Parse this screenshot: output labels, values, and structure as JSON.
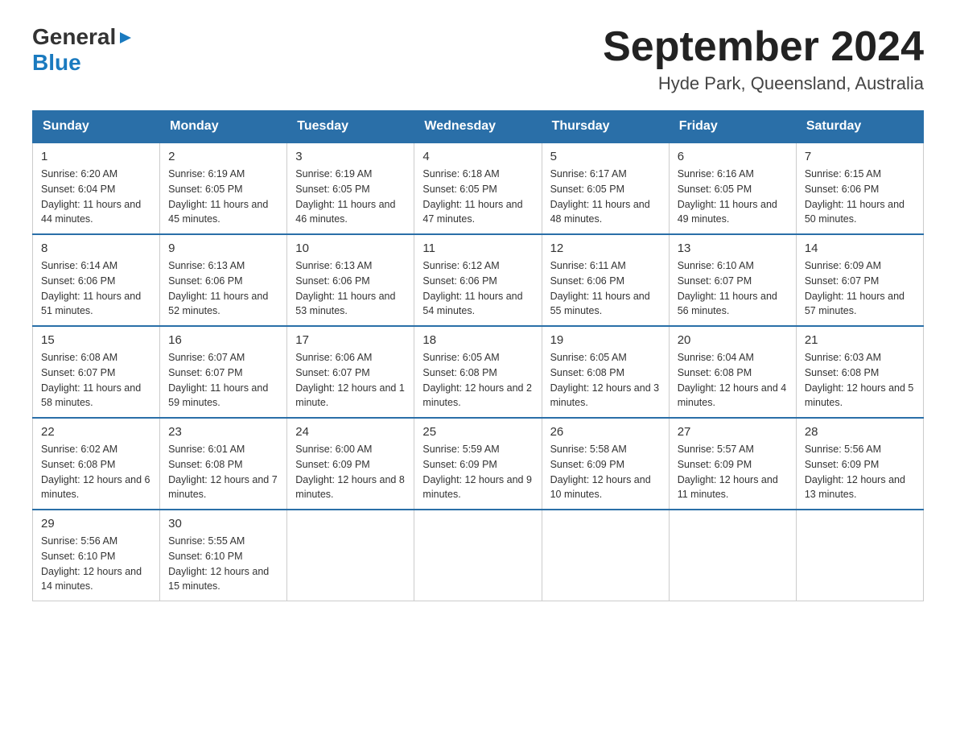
{
  "header": {
    "logo_general": "General",
    "logo_blue": "Blue",
    "main_title": "September 2024",
    "subtitle": "Hyde Park, Queensland, Australia"
  },
  "calendar": {
    "days_of_week": [
      "Sunday",
      "Monday",
      "Tuesday",
      "Wednesday",
      "Thursday",
      "Friday",
      "Saturday"
    ],
    "weeks": [
      [
        {
          "day": "1",
          "sunrise": "6:20 AM",
          "sunset": "6:04 PM",
          "daylight": "11 hours and 44 minutes."
        },
        {
          "day": "2",
          "sunrise": "6:19 AM",
          "sunset": "6:05 PM",
          "daylight": "11 hours and 45 minutes."
        },
        {
          "day": "3",
          "sunrise": "6:19 AM",
          "sunset": "6:05 PM",
          "daylight": "11 hours and 46 minutes."
        },
        {
          "day": "4",
          "sunrise": "6:18 AM",
          "sunset": "6:05 PM",
          "daylight": "11 hours and 47 minutes."
        },
        {
          "day": "5",
          "sunrise": "6:17 AM",
          "sunset": "6:05 PM",
          "daylight": "11 hours and 48 minutes."
        },
        {
          "day": "6",
          "sunrise": "6:16 AM",
          "sunset": "6:05 PM",
          "daylight": "11 hours and 49 minutes."
        },
        {
          "day": "7",
          "sunrise": "6:15 AM",
          "sunset": "6:06 PM",
          "daylight": "11 hours and 50 minutes."
        }
      ],
      [
        {
          "day": "8",
          "sunrise": "6:14 AM",
          "sunset": "6:06 PM",
          "daylight": "11 hours and 51 minutes."
        },
        {
          "day": "9",
          "sunrise": "6:13 AM",
          "sunset": "6:06 PM",
          "daylight": "11 hours and 52 minutes."
        },
        {
          "day": "10",
          "sunrise": "6:13 AM",
          "sunset": "6:06 PM",
          "daylight": "11 hours and 53 minutes."
        },
        {
          "day": "11",
          "sunrise": "6:12 AM",
          "sunset": "6:06 PM",
          "daylight": "11 hours and 54 minutes."
        },
        {
          "day": "12",
          "sunrise": "6:11 AM",
          "sunset": "6:06 PM",
          "daylight": "11 hours and 55 minutes."
        },
        {
          "day": "13",
          "sunrise": "6:10 AM",
          "sunset": "6:07 PM",
          "daylight": "11 hours and 56 minutes."
        },
        {
          "day": "14",
          "sunrise": "6:09 AM",
          "sunset": "6:07 PM",
          "daylight": "11 hours and 57 minutes."
        }
      ],
      [
        {
          "day": "15",
          "sunrise": "6:08 AM",
          "sunset": "6:07 PM",
          "daylight": "11 hours and 58 minutes."
        },
        {
          "day": "16",
          "sunrise": "6:07 AM",
          "sunset": "6:07 PM",
          "daylight": "11 hours and 59 minutes."
        },
        {
          "day": "17",
          "sunrise": "6:06 AM",
          "sunset": "6:07 PM",
          "daylight": "12 hours and 1 minute."
        },
        {
          "day": "18",
          "sunrise": "6:05 AM",
          "sunset": "6:08 PM",
          "daylight": "12 hours and 2 minutes."
        },
        {
          "day": "19",
          "sunrise": "6:05 AM",
          "sunset": "6:08 PM",
          "daylight": "12 hours and 3 minutes."
        },
        {
          "day": "20",
          "sunrise": "6:04 AM",
          "sunset": "6:08 PM",
          "daylight": "12 hours and 4 minutes."
        },
        {
          "day": "21",
          "sunrise": "6:03 AM",
          "sunset": "6:08 PM",
          "daylight": "12 hours and 5 minutes."
        }
      ],
      [
        {
          "day": "22",
          "sunrise": "6:02 AM",
          "sunset": "6:08 PM",
          "daylight": "12 hours and 6 minutes."
        },
        {
          "day": "23",
          "sunrise": "6:01 AM",
          "sunset": "6:08 PM",
          "daylight": "12 hours and 7 minutes."
        },
        {
          "day": "24",
          "sunrise": "6:00 AM",
          "sunset": "6:09 PM",
          "daylight": "12 hours and 8 minutes."
        },
        {
          "day": "25",
          "sunrise": "5:59 AM",
          "sunset": "6:09 PM",
          "daylight": "12 hours and 9 minutes."
        },
        {
          "day": "26",
          "sunrise": "5:58 AM",
          "sunset": "6:09 PM",
          "daylight": "12 hours and 10 minutes."
        },
        {
          "day": "27",
          "sunrise": "5:57 AM",
          "sunset": "6:09 PM",
          "daylight": "12 hours and 11 minutes."
        },
        {
          "day": "28",
          "sunrise": "5:56 AM",
          "sunset": "6:09 PM",
          "daylight": "12 hours and 13 minutes."
        }
      ],
      [
        {
          "day": "29",
          "sunrise": "5:56 AM",
          "sunset": "6:10 PM",
          "daylight": "12 hours and 14 minutes."
        },
        {
          "day": "30",
          "sunrise": "5:55 AM",
          "sunset": "6:10 PM",
          "daylight": "12 hours and 15 minutes."
        },
        null,
        null,
        null,
        null,
        null
      ]
    ],
    "labels": {
      "sunrise": "Sunrise:",
      "sunset": "Sunset:",
      "daylight": "Daylight:"
    }
  }
}
